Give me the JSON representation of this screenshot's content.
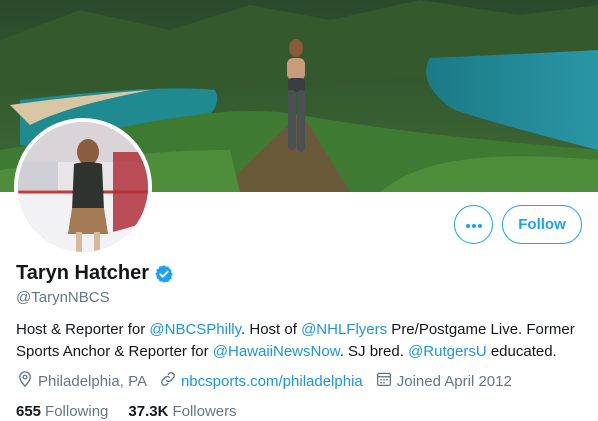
{
  "profile": {
    "display_name": "Taryn Hatcher",
    "handle": "@TarynNBCS",
    "verified_icon": "verified-badge-icon",
    "bio": {
      "t1": "Host & Reporter for ",
      "m1": "@NBCSPhilly",
      "t2": ". Host of ",
      "m2": "@NHLFlyers",
      "t3": " Pre/Postgame Live. Former Sports Anchor & Reporter for ",
      "m3": "@HawaiiNewsNow",
      "t4": ". SJ bred. ",
      "m4": "@RutgersU",
      "t5": " educated."
    },
    "location": "Philadelphia, PA",
    "website": "nbcsports.com/philadelphia",
    "joined": "Joined April 2012",
    "following_count": "655",
    "following_label": "Following",
    "followers_count": "37.3K",
    "followers_label": "Followers"
  },
  "actions": {
    "more_icon": "more-horizontal-icon",
    "follow_label": "Follow"
  },
  "colors": {
    "accent": "#1da1f2",
    "link": "#1b95e0",
    "secondary_text": "#657786",
    "primary_text": "#14171a"
  }
}
